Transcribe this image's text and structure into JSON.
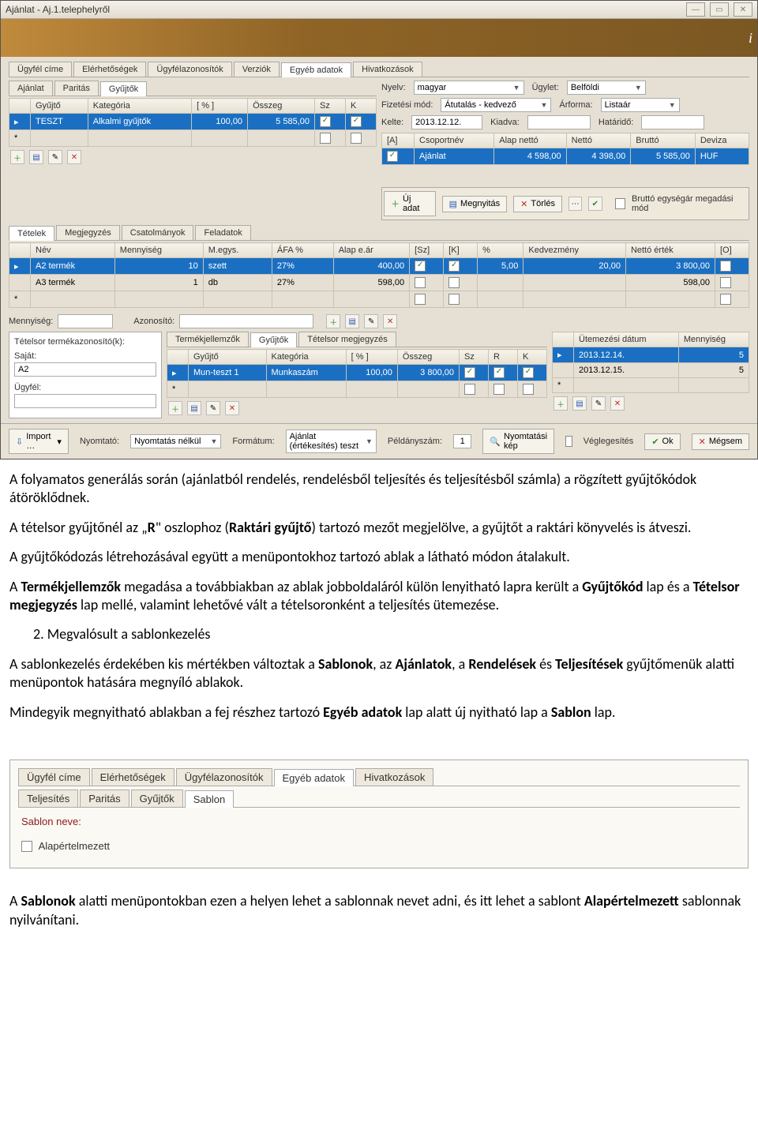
{
  "titlebar": {
    "title": "Ajánlat - Aj.1.telephelyről"
  },
  "tabs1": {
    "items": [
      "Ügyfél címe",
      "Elérhetőségek",
      "Ügyfélazonosítók",
      "Verziók",
      "Egyéb adatok",
      "Hivatkozások"
    ],
    "active": "Egyéb adatok"
  },
  "tabs2": {
    "items": [
      "Ajánlat",
      "Paritás",
      "Gyűjtők"
    ],
    "active": "Gyűjtők"
  },
  "gyujtok_grid": {
    "headers": [
      "Gyűjtő",
      "Kategória",
      "[ % ]",
      "Összeg",
      "Sz",
      "K"
    ],
    "rows": [
      {
        "sel": true,
        "gyujto": "TESZT",
        "kategoria": "Alkalmi gyűjtők",
        "pct": "100,00",
        "osszeg": "5 585,00",
        "sz": true,
        "k": true
      },
      {
        "sel": false,
        "gyujto": "",
        "kategoria": "",
        "pct": "",
        "osszeg": "",
        "sz": false,
        "k": false
      }
    ]
  },
  "header_right": {
    "nyelv_lbl": "Nyelv:",
    "nyelv": "magyar",
    "ugylet_lbl": "Ügylet:",
    "ugylet": "Belföldi",
    "fiz_lbl": "Fizetési mód:",
    "fiz": "Átutalás - kedvező",
    "arforma_lbl": "Árforma:",
    "arforma": "Listaár",
    "kelte_lbl": "Kelte:",
    "kelte": "2013.12.12.",
    "kiadva_lbl": "Kiadva:",
    "kiadva": "",
    "hatarido_lbl": "Határidő:",
    "hatarido": ""
  },
  "csoport_grid": {
    "headers": [
      "[A]",
      "Csoportnév",
      "Alap nettó",
      "Nettó",
      "Bruttó",
      "Deviza"
    ],
    "row": {
      "a": true,
      "nev": "Ajánlat",
      "alap": "4 598,00",
      "netto": "4 398,00",
      "brutto": "5 585,00",
      "deviza": "HUF"
    }
  },
  "actionbar": {
    "ujadat": "Új adat",
    "megnyitas": "Megnyitás",
    "torles": "Törlés",
    "brutto_chk": "Bruttó egységár megadási mód"
  },
  "tabs3": {
    "items": [
      "Tételek",
      "Megjegyzés",
      "Csatolmányok",
      "Feladatok"
    ],
    "active": "Tételek"
  },
  "tetelek_grid": {
    "headers": [
      "Név",
      "Mennyiség",
      "M.egys.",
      "ÁFA %",
      "Alap e.ár",
      "[Sz]",
      "[K]",
      "%",
      "Kedvezmény",
      "Nettó érték",
      "[O]"
    ],
    "rows": [
      {
        "sel": true,
        "nev": "A2 termék",
        "menny": "10",
        "megys": "szett",
        "afa": "27%",
        "alap": "400,00",
        "sz": true,
        "k": true,
        "pct": "5,00",
        "kedv": "20,00",
        "netto": "3 800,00",
        "o": false
      },
      {
        "sel": false,
        "nev": "A3 termék",
        "menny": "1",
        "megys": "db",
        "afa": "27%",
        "alap": "598,00",
        "sz": false,
        "k": false,
        "pct": "",
        "kedv": "",
        "netto": "598,00",
        "o": false
      },
      {
        "sel": false,
        "nev": "",
        "menny": "",
        "megys": "",
        "afa": "",
        "alap": "",
        "sz": false,
        "k": false,
        "pct": "",
        "kedv": "",
        "netto": "",
        "o": false
      }
    ]
  },
  "midlabels": {
    "menny": "Mennyiség:",
    "azon": "Azonosító:"
  },
  "leftbox": {
    "title": "Tételsor termékazonosító(k):",
    "sajat_lbl": "Saját:",
    "sajat": "A2",
    "ugyfel_lbl": "Ügyfél:",
    "ugyfel": ""
  },
  "tabs4": {
    "items": [
      "Termékjellemzők",
      "Gyűjtők",
      "Tételsor megjegyzés"
    ],
    "active": "Gyűjtők"
  },
  "gyujtok2_grid": {
    "headers": [
      "Gyűjtő",
      "Kategória",
      "[ % ]",
      "Összeg",
      "Sz",
      "R",
      "K"
    ],
    "rows": [
      {
        "sel": true,
        "gyujto": "Mun-teszt 1",
        "kategoria": "Munkaszám",
        "pct": "100,00",
        "osszeg": "3 800,00",
        "sz": true,
        "r": true,
        "k": true
      },
      {
        "sel": false,
        "gyujto": "",
        "kategoria": "",
        "pct": "",
        "osszeg": "",
        "sz": false,
        "r": false,
        "k": false
      }
    ]
  },
  "utem_grid": {
    "headers": [
      "Ütemezési dátum",
      "Mennyiség"
    ],
    "rows": [
      {
        "sel": true,
        "datum": "2013.12.14.",
        "menny": "5"
      },
      {
        "sel": false,
        "datum": "2013.12.15.",
        "menny": "5"
      },
      {
        "sel": false,
        "datum": "",
        "menny": ""
      }
    ]
  },
  "footer": {
    "import": "Import …",
    "nyomtato_lbl": "Nyomtató:",
    "nyomtato": "Nyomtatás nélkül",
    "formatum_lbl": "Formátum:",
    "formatum": "Ajánlat (értékesítés) teszt",
    "peldany_lbl": "Példányszám:",
    "peldany": "1",
    "nyomtkep": "Nyomtatási kép",
    "vegleg": "Véglegesítés",
    "ok": "Ok",
    "megsem": "Mégsem"
  },
  "body_text": {
    "p1": "A folyamatos generálás során (ajánlatból rendelés, rendelésből teljesítés és teljesítésből számla) a rögzített gyűjtőkódok átöröklődnek.",
    "p2a": "A tételsor gyűjtőnél az „",
    "p2b": "R",
    "p2c": "\" oszlophoz (",
    "p2d": "Raktári gyűjtő",
    "p2e": ") tartozó mezőt megjelölve, a gyűjtőt a raktári könyvelés is átveszi.",
    "p3": "A gyűjtőkódozás létrehozásával együtt a menüpontokhoz tartozó ablak a látható módon átalakult.",
    "p4a": "A ",
    "p4b": "Termékjellemzők",
    "p4c": " megadása a továbbiakban az ablak jobboldaláról külön lenyitható lapra került a ",
    "p4d": "Gyűjtőkód",
    "p4e": " lap és a ",
    "p4f": "Tételsor megjegyzés",
    "p4g": " lap mellé, valamint lehetővé vált a tételsoronként a teljesítés ütemezése.",
    "p5": "2.   Megvalósult a sablonkezelés",
    "p6a": "A sablonkezelés érdekében kis mértékben változtak a ",
    "p6b": "Sablonok",
    "p6c": ", az ",
    "p6d": "Ajánlatok",
    "p6e": ", a ",
    "p6f": "Rendelések",
    "p6g": " és ",
    "p6h": "Teljesítések",
    "p6i": " gyűjtőmenük alatti menüpontok hatására megnyíló ablakok.",
    "p7a": "Mindegyik megnyitható ablakban a fej részhez tartozó ",
    "p7b": "Egyéb adatok",
    "p7c": " lap alatt új nyitható lap a ",
    "p7d": "Sablon",
    "p7e": " lap."
  },
  "shot2": {
    "tabs1": [
      "Ügyfél címe",
      "Elérhetőségek",
      "Ügyfélazonosítók",
      "Egyéb adatok",
      "Hivatkozások"
    ],
    "tabs1_active": "Egyéb adatok",
    "tabs2": [
      "Teljesítés",
      "Paritás",
      "Gyűjtők",
      "Sablon"
    ],
    "tabs2_active": "Sablon",
    "sablon_lbl": "Sablon neve:",
    "alap_lbl": "Alapértelmezett"
  },
  "closing": {
    "p1a": "A ",
    "p1b": "Sablonok",
    "p1c": " alatti menüpontokban ezen a helyen lehet a sablonnak nevet adni, és itt lehet a sablont ",
    "p1d": "Alapértelmezett",
    "p1e": " sablonnak nyilvánítani."
  }
}
